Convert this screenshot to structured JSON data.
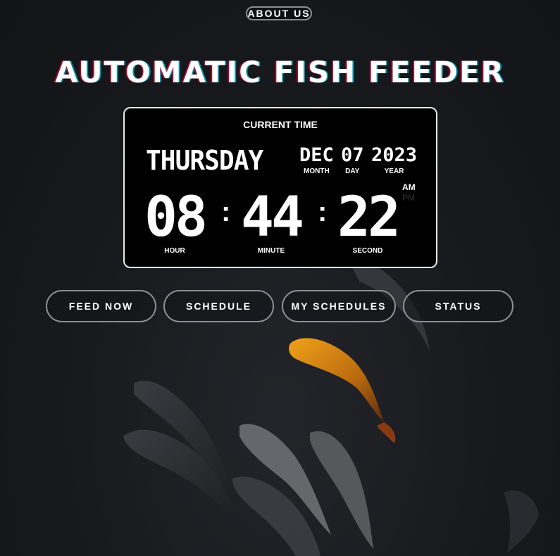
{
  "nav": {
    "about_label": "ABOUT US"
  },
  "header": {
    "title": "AUTOMATIC FISH FEEDER"
  },
  "clock": {
    "label": "CURRENT TIME",
    "weekday": "THURSDAY",
    "month": "DEC",
    "month_label": "MONTH",
    "day": "07",
    "day_label": "DAY",
    "year": "2023",
    "year_label": "YEAR",
    "hour": "08",
    "hour_label": "HOUR",
    "minute": "44",
    "minute_label": "MINUTE",
    "second": "22",
    "second_label": "SECOND",
    "am": "AM",
    "pm": "PM",
    "separator": ":"
  },
  "actions": {
    "feed_now": "FEED NOW",
    "schedule": "SCHEDULE",
    "my_schedules": "MY SCHEDULES",
    "status": "STATUS"
  }
}
